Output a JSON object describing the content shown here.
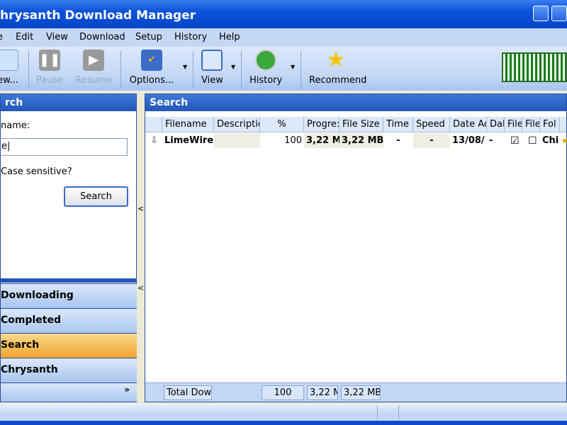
{
  "window": {
    "title": "hrysanth Download Manager"
  },
  "menu": [
    "e",
    "Edit",
    "View",
    "Download",
    "Setup",
    "History",
    "Help"
  ],
  "toolbar": {
    "new": "ew...",
    "pause": "Pause",
    "resume": "Resume",
    "options": "Options...",
    "view": "View",
    "history": "History",
    "recommend": "Recommend"
  },
  "left": {
    "header": "rch",
    "name_label": "name:",
    "name_value": "e",
    "case_label": "Case sensitive?",
    "search_button": "Search",
    "nav": [
      {
        "label": "Downloading",
        "active": false
      },
      {
        "label": "Completed",
        "active": false
      },
      {
        "label": "Search",
        "active": true
      },
      {
        "label": "Chrysanth",
        "active": false
      }
    ]
  },
  "right": {
    "header": "Search",
    "columns": [
      "Filename",
      "Descriptic",
      "%",
      "Progre:",
      "File Size",
      "Time F",
      "Speed",
      "Date Ac",
      "Dal",
      "File",
      "File",
      "Fol"
    ],
    "rows": [
      {
        "filename": "LimeWire'",
        "description": "",
        "percent": "100",
        "progress": "3,22 M",
        "file_size": "3,22 MB",
        "time": "-",
        "speed": "-",
        "date": "13/08/",
        "dal": "-",
        "file1_checked": true,
        "file2_checked": false,
        "folder": "Chi"
      }
    ],
    "footer": {
      "total": "Total Dow",
      "percent": "100",
      "progress": "3,22 M",
      "file_size": "3,22 MB"
    }
  }
}
